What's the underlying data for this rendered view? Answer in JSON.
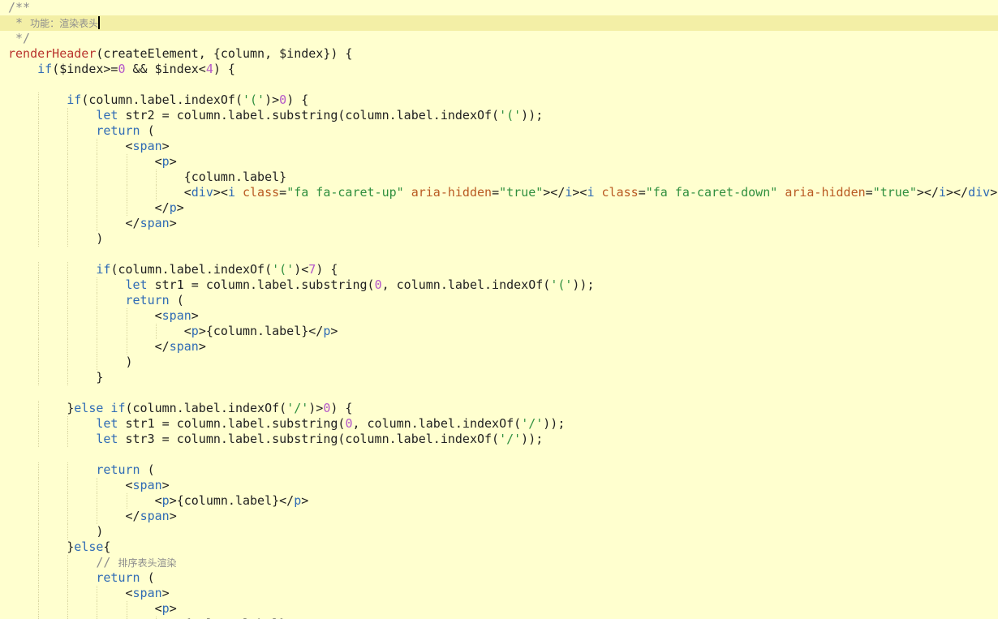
{
  "editor": {
    "theme": {
      "background": "#ffffcf",
      "active_line": "#f3efa6",
      "comment": "#8e8e8e",
      "function": "#b9342e",
      "keyword": "#2f6bb5",
      "number": "#b457c9",
      "string": "#2f8f3e",
      "tag": "#2f6bb5",
      "attribute": "#b95a22"
    },
    "active_line_index": 1,
    "lines": [
      {
        "indent": 0,
        "tokens": [
          [
            "cmt",
            "/**"
          ]
        ]
      },
      {
        "indent": 0,
        "cursor": true,
        "tokens": [
          [
            "cmt",
            " * "
          ],
          [
            "cmtcn",
            "功能：渲染表头"
          ]
        ]
      },
      {
        "indent": 0,
        "tokens": [
          [
            "cmt",
            " */"
          ]
        ]
      },
      {
        "indent": 0,
        "tokens": [
          [
            "fn",
            "renderHeader"
          ],
          [
            "pl",
            "(createElement, {column, $index}) {"
          ]
        ]
      },
      {
        "indent": 1,
        "tokens": [
          [
            "kw",
            "if"
          ],
          [
            "pl",
            "($index>="
          ],
          [
            "num",
            "0"
          ],
          [
            "pl",
            " && $index<"
          ],
          [
            "num",
            "4"
          ],
          [
            "pl",
            ") {"
          ]
        ]
      },
      {
        "indent": 0,
        "tokens": []
      },
      {
        "indent": 2,
        "tokens": [
          [
            "kw",
            "if"
          ],
          [
            "pl",
            "(column.label.indexOf("
          ],
          [
            "str",
            "'('"
          ],
          [
            "pl",
            ")>"
          ],
          [
            "num",
            "0"
          ],
          [
            "pl",
            ") {"
          ]
        ]
      },
      {
        "indent": 3,
        "tokens": [
          [
            "kw",
            "let"
          ],
          [
            "pl",
            " str2 = column.label.substring(column.label.indexOf("
          ],
          [
            "str",
            "'('"
          ],
          [
            "pl",
            "));"
          ]
        ]
      },
      {
        "indent": 3,
        "tokens": [
          [
            "kw",
            "return"
          ],
          [
            "pl",
            " ("
          ]
        ]
      },
      {
        "indent": 4,
        "tokens": [
          [
            "pl",
            "<"
          ],
          [
            "tag",
            "span"
          ],
          [
            "pl",
            ">"
          ]
        ]
      },
      {
        "indent": 5,
        "tokens": [
          [
            "pl",
            "<"
          ],
          [
            "tag",
            "p"
          ],
          [
            "pl",
            ">"
          ]
        ]
      },
      {
        "indent": 6,
        "tokens": [
          [
            "pl",
            "{column.label}"
          ]
        ]
      },
      {
        "indent": 6,
        "tokens": [
          [
            "pl",
            "<"
          ],
          [
            "tag",
            "div"
          ],
          [
            "pl",
            "><"
          ],
          [
            "tag",
            "i"
          ],
          [
            "pl",
            " "
          ],
          [
            "attr",
            "class"
          ],
          [
            "pl",
            "="
          ],
          [
            "aval",
            "\"fa fa-caret-up\""
          ],
          [
            "pl",
            " "
          ],
          [
            "attr",
            "aria-hidden"
          ],
          [
            "pl",
            "="
          ],
          [
            "aval",
            "\"true\""
          ],
          [
            "pl",
            "></"
          ],
          [
            "tag",
            "i"
          ],
          [
            "pl",
            "><"
          ],
          [
            "tag",
            "i"
          ],
          [
            "pl",
            " "
          ],
          [
            "attr",
            "class"
          ],
          [
            "pl",
            "="
          ],
          [
            "aval",
            "\"fa fa-caret-down\""
          ],
          [
            "pl",
            " "
          ],
          [
            "attr",
            "aria-hidden"
          ],
          [
            "pl",
            "="
          ],
          [
            "aval",
            "\"true\""
          ],
          [
            "pl",
            "></"
          ],
          [
            "tag",
            "i"
          ],
          [
            "pl",
            "></"
          ],
          [
            "tag",
            "div"
          ],
          [
            "pl",
            ">"
          ]
        ]
      },
      {
        "indent": 5,
        "tokens": [
          [
            "pl",
            "</"
          ],
          [
            "tag",
            "p"
          ],
          [
            "pl",
            ">"
          ]
        ]
      },
      {
        "indent": 4,
        "tokens": [
          [
            "pl",
            "</"
          ],
          [
            "tag",
            "span"
          ],
          [
            "pl",
            ">"
          ]
        ]
      },
      {
        "indent": 3,
        "tokens": [
          [
            "pl",
            ")"
          ]
        ]
      },
      {
        "indent": 0,
        "tokens": []
      },
      {
        "indent": 3,
        "tokens": [
          [
            "kw",
            "if"
          ],
          [
            "pl",
            "(column.label.indexOf("
          ],
          [
            "str",
            "'('"
          ],
          [
            "pl",
            ")<"
          ],
          [
            "num",
            "7"
          ],
          [
            "pl",
            ") {"
          ]
        ]
      },
      {
        "indent": 4,
        "tokens": [
          [
            "kw",
            "let"
          ],
          [
            "pl",
            " str1 = column.label.substring("
          ],
          [
            "num",
            "0"
          ],
          [
            "pl",
            ", column.label.indexOf("
          ],
          [
            "str",
            "'('"
          ],
          [
            "pl",
            "));"
          ]
        ]
      },
      {
        "indent": 4,
        "tokens": [
          [
            "kw",
            "return"
          ],
          [
            "pl",
            " ("
          ]
        ]
      },
      {
        "indent": 5,
        "tokens": [
          [
            "pl",
            "<"
          ],
          [
            "tag",
            "span"
          ],
          [
            "pl",
            ">"
          ]
        ]
      },
      {
        "indent": 6,
        "tokens": [
          [
            "pl",
            "<"
          ],
          [
            "tag",
            "p"
          ],
          [
            "pl",
            ">{column.label}</"
          ],
          [
            "tag",
            "p"
          ],
          [
            "pl",
            ">"
          ]
        ]
      },
      {
        "indent": 5,
        "tokens": [
          [
            "pl",
            "</"
          ],
          [
            "tag",
            "span"
          ],
          [
            "pl",
            ">"
          ]
        ]
      },
      {
        "indent": 4,
        "tokens": [
          [
            "pl",
            ")"
          ]
        ]
      },
      {
        "indent": 3,
        "tokens": [
          [
            "pl",
            "}"
          ]
        ]
      },
      {
        "indent": 0,
        "tokens": []
      },
      {
        "indent": 2,
        "tokens": [
          [
            "pl",
            "}"
          ],
          [
            "kw",
            "else if"
          ],
          [
            "pl",
            "(column.label.indexOf("
          ],
          [
            "str",
            "'/'"
          ],
          [
            "pl",
            ")>"
          ],
          [
            "num",
            "0"
          ],
          [
            "pl",
            ") {"
          ]
        ]
      },
      {
        "indent": 3,
        "tokens": [
          [
            "kw",
            "let"
          ],
          [
            "pl",
            " str1 = column.label.substring("
          ],
          [
            "num",
            "0"
          ],
          [
            "pl",
            ", column.label.indexOf("
          ],
          [
            "str",
            "'/'"
          ],
          [
            "pl",
            "));"
          ]
        ]
      },
      {
        "indent": 3,
        "tokens": [
          [
            "kw",
            "let"
          ],
          [
            "pl",
            " str3 = column.label.substring(column.label.indexOf("
          ],
          [
            "str",
            "'/'"
          ],
          [
            "pl",
            "));"
          ]
        ]
      },
      {
        "indent": 0,
        "tokens": []
      },
      {
        "indent": 3,
        "tokens": [
          [
            "kw",
            "return"
          ],
          [
            "pl",
            " ("
          ]
        ]
      },
      {
        "indent": 4,
        "tokens": [
          [
            "pl",
            "<"
          ],
          [
            "tag",
            "span"
          ],
          [
            "pl",
            ">"
          ]
        ]
      },
      {
        "indent": 5,
        "tokens": [
          [
            "pl",
            "<"
          ],
          [
            "tag",
            "p"
          ],
          [
            "pl",
            ">{column.label}</"
          ],
          [
            "tag",
            "p"
          ],
          [
            "pl",
            ">"
          ]
        ]
      },
      {
        "indent": 4,
        "tokens": [
          [
            "pl",
            "</"
          ],
          [
            "tag",
            "span"
          ],
          [
            "pl",
            ">"
          ]
        ]
      },
      {
        "indent": 3,
        "tokens": [
          [
            "pl",
            ")"
          ]
        ]
      },
      {
        "indent": 2,
        "tokens": [
          [
            "pl",
            "}"
          ],
          [
            "kw",
            "else"
          ],
          [
            "pl",
            "{"
          ]
        ]
      },
      {
        "indent": 3,
        "tokens": [
          [
            "cmt",
            "// "
          ],
          [
            "cmtcn",
            "排序表头渲染"
          ]
        ]
      },
      {
        "indent": 3,
        "tokens": [
          [
            "kw",
            "return"
          ],
          [
            "pl",
            " ("
          ]
        ]
      },
      {
        "indent": 4,
        "tokens": [
          [
            "pl",
            "<"
          ],
          [
            "tag",
            "span"
          ],
          [
            "pl",
            ">"
          ]
        ]
      },
      {
        "indent": 5,
        "tokens": [
          [
            "pl",
            "<"
          ],
          [
            "tag",
            "p"
          ],
          [
            "pl",
            ">"
          ]
        ]
      },
      {
        "indent": 6,
        "tokens": [
          [
            "pl",
            "{column.label}"
          ]
        ]
      }
    ]
  }
}
